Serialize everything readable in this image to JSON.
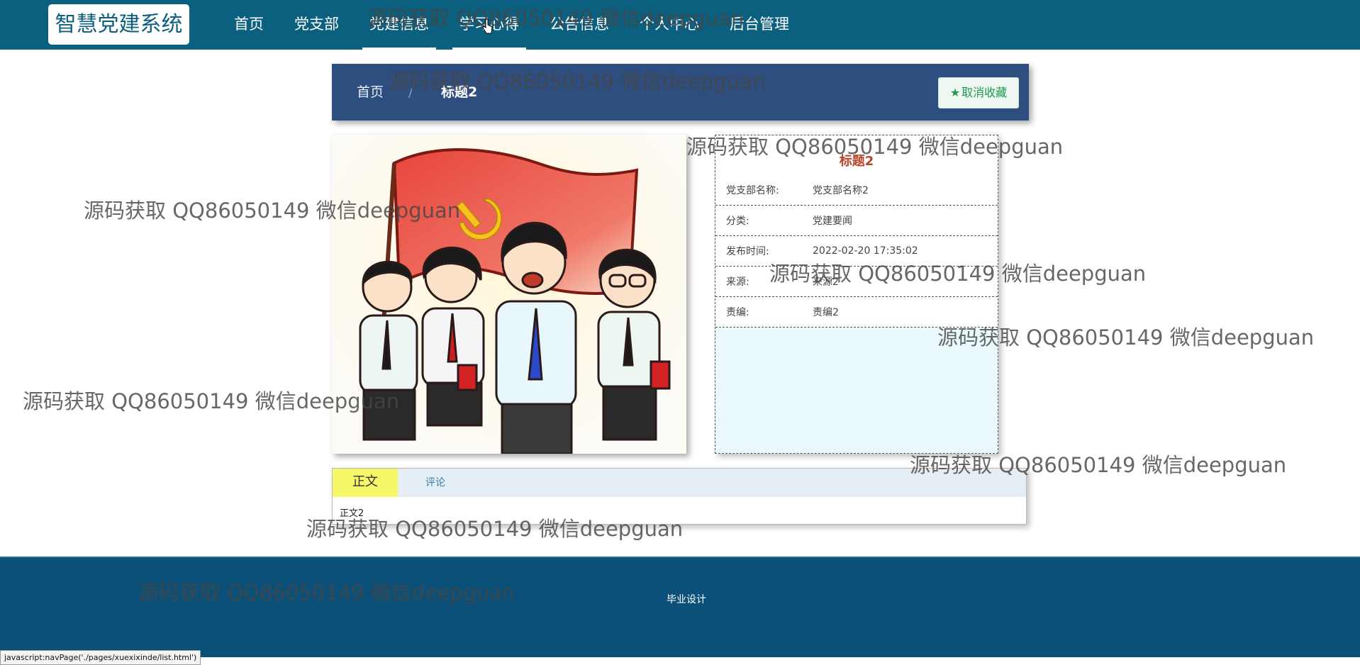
{
  "app": {
    "logo": "智慧党建系统"
  },
  "nav": {
    "items": [
      {
        "label": "首页",
        "active": false
      },
      {
        "label": "党支部",
        "active": false
      },
      {
        "label": "党建信息",
        "active": true
      },
      {
        "label": "学习心得",
        "active": true
      },
      {
        "label": "公告信息",
        "active": false
      },
      {
        "label": "个人中心",
        "active": false
      },
      {
        "label": "后台管理",
        "active": false
      }
    ]
  },
  "breadcrumb": {
    "home": "首页",
    "separator": "/",
    "current": "标题2"
  },
  "favorite_button": {
    "label": "取消收藏",
    "icon": "star-icon"
  },
  "detail": {
    "title": "标题2",
    "rows": [
      {
        "key": "党支部名称:",
        "value": "党支部名称2"
      },
      {
        "key": "分类:",
        "value": "党建要闻"
      },
      {
        "key": "发布时间:",
        "value": "2022-02-20 17:35:02"
      },
      {
        "key": "来源:",
        "value": "来源2"
      },
      {
        "key": "责编:",
        "value": "责编2"
      }
    ]
  },
  "tabs": {
    "main": "正文",
    "comment": "评论",
    "content": "正文2"
  },
  "footer": {
    "text": "毕业设计"
  },
  "status_bar": {
    "text": "javascript:navPage('./pages/xuexixinde/list.html')"
  },
  "watermark": {
    "text": "源码获取 QQ86050149 微信deepguan"
  },
  "colors": {
    "nav_bg": "#0b5f7f",
    "breadcrumb_bg": "#2d4e7e",
    "footer_bg": "#0b5079",
    "title_accent": "#b8442a",
    "tab_active": "#f7f76a"
  }
}
